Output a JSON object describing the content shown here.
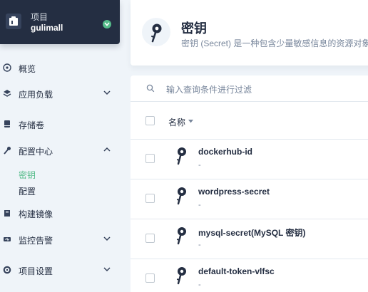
{
  "project": {
    "label": "项目",
    "name": "gulimall"
  },
  "nav": {
    "overview": "概览",
    "workloads": "应用负载",
    "volumes": "存储卷",
    "config_center": "配置中心",
    "config_sub": {
      "secrets": "密钥",
      "configmaps": "配置"
    },
    "image_builder": "构建镜像",
    "monitoring": "监控告警",
    "project_settings": "项目设置"
  },
  "header": {
    "title": "密钥",
    "description": "密钥 (Secret) 是一种包含少量敏感信息的资源对象"
  },
  "filter": {
    "placeholder": "输入查询条件进行过滤"
  },
  "table": {
    "column_name": "名称",
    "rows": [
      {
        "name": "dockerhub-id",
        "sub": "-"
      },
      {
        "name": "wordpress-secret",
        "sub": "-"
      },
      {
        "name": "mysql-secret(MySQL 密钥)",
        "sub": "-"
      },
      {
        "name": "default-token-vlfsc",
        "sub": "-"
      }
    ]
  },
  "colors": {
    "accent": "#55bc8a",
    "dark": "#242e42",
    "muted": "#79879c",
    "bg": "#eff4f9"
  }
}
